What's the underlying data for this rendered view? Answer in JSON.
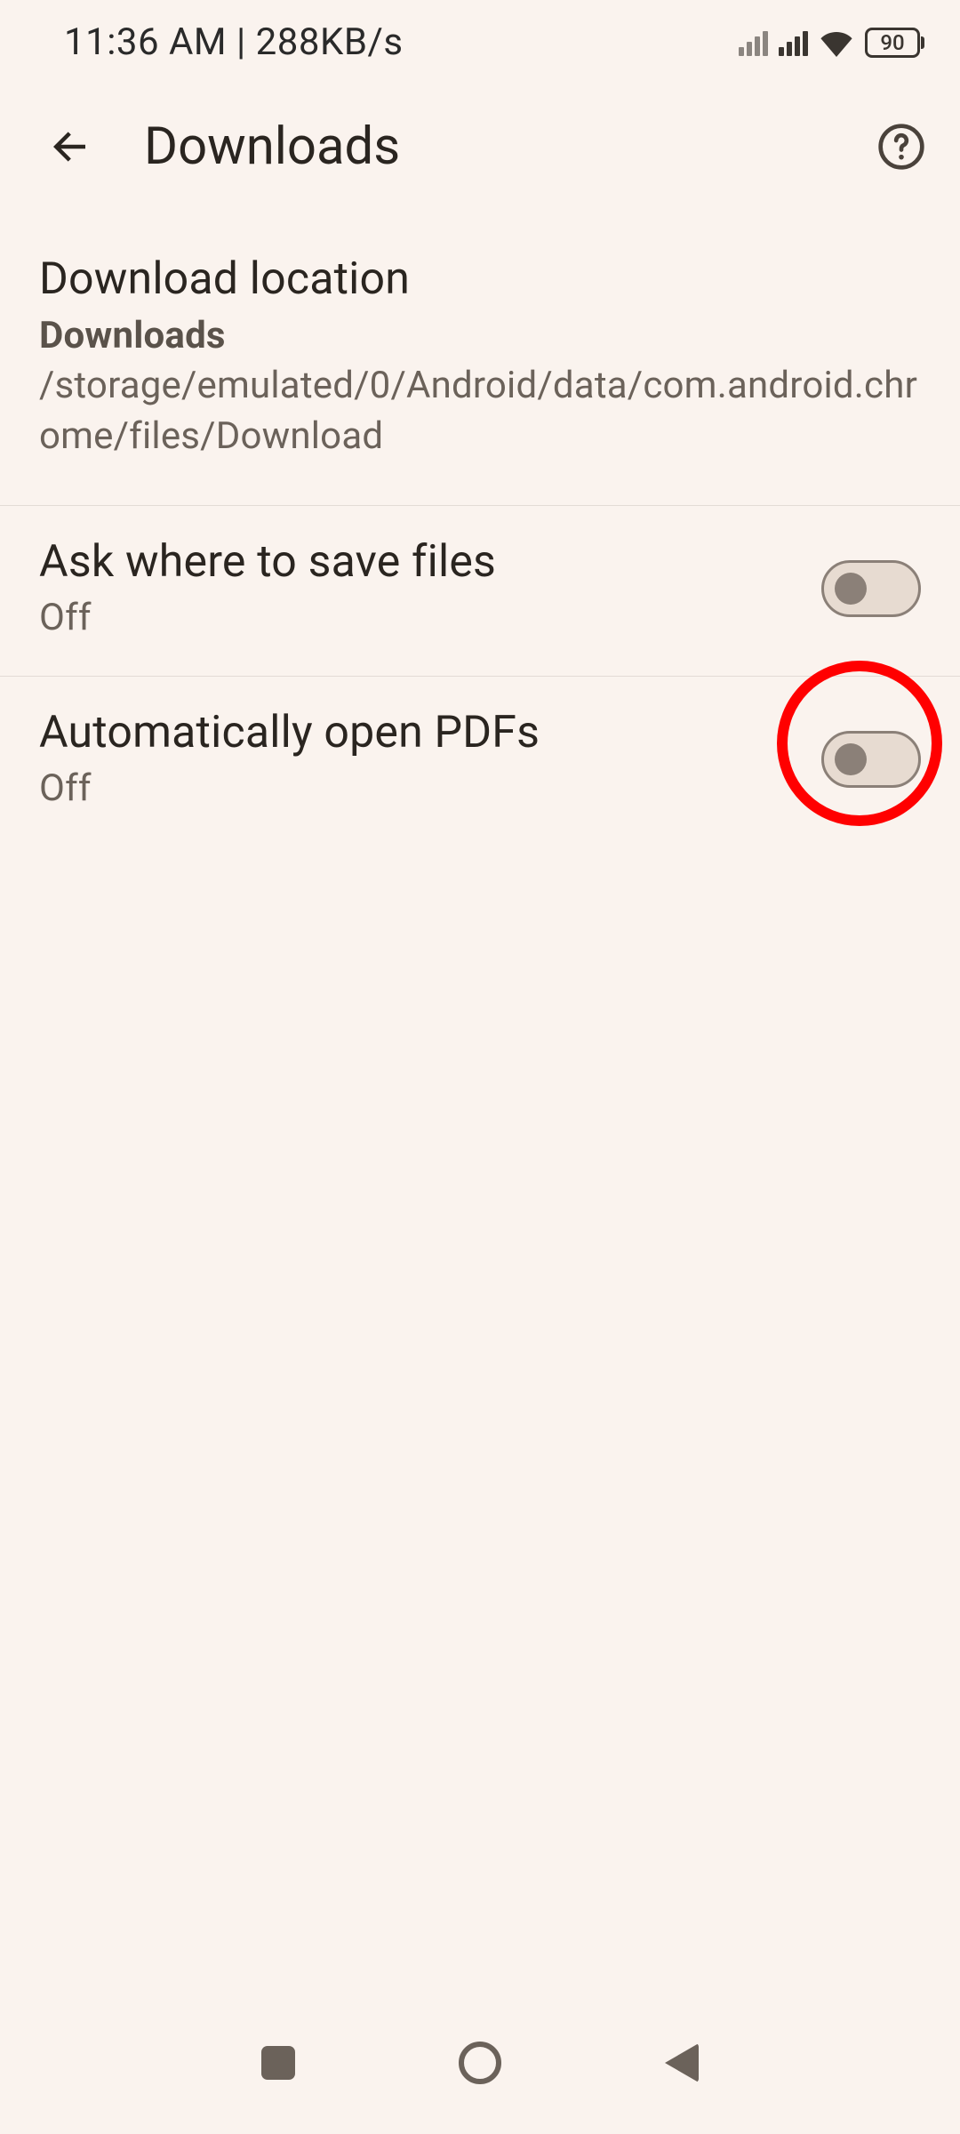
{
  "status_bar": {
    "time_and_speed": "11:36 AM | 288KB/s",
    "battery_level": "90"
  },
  "app_bar": {
    "title": "Downloads"
  },
  "settings": {
    "download_location": {
      "title": "Download location",
      "path_prefix": "Downloads",
      "path_rest": " /storage/emulated/0/Android/data/com.android.chrome/files/Download"
    },
    "ask_where": {
      "title": "Ask where to save files",
      "status": "Off",
      "toggle_on": false
    },
    "auto_open_pdfs": {
      "title": "Automatically open PDFs",
      "status": "Off",
      "toggle_on": false
    }
  },
  "annotation": {
    "highlight_target": "auto-open-pdfs-toggle"
  }
}
